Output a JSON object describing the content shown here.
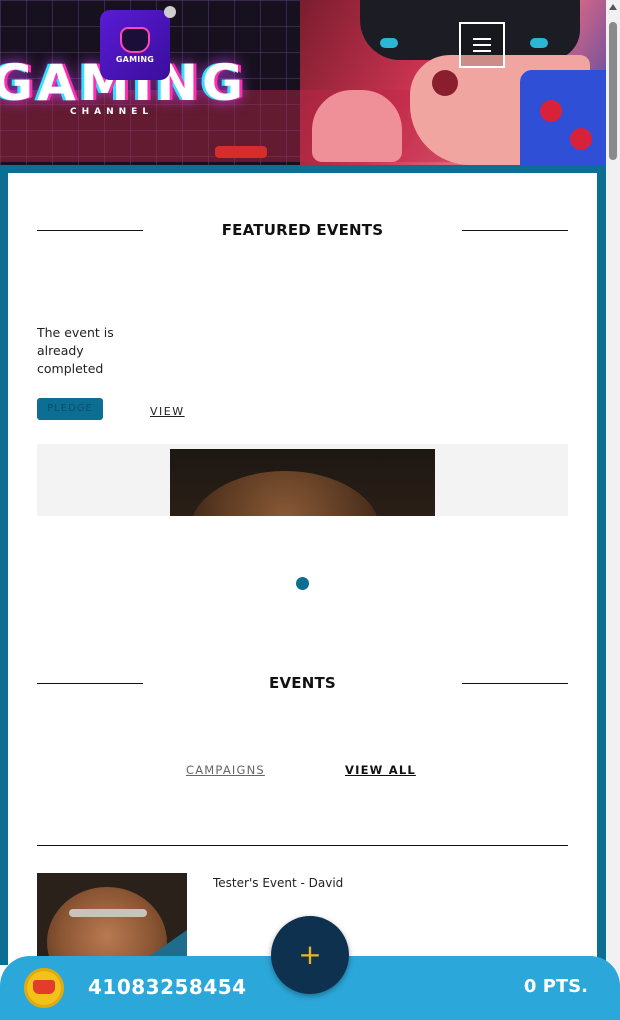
{
  "header": {
    "logo_text": "GAMING",
    "banner_title": "GAMING",
    "banner_subtitle": "CHANNEL",
    "menu_icon": "hamburger-icon"
  },
  "featured": {
    "heading": "FEATURED EVENTS",
    "status_text": "The event is already completed",
    "pledge_label": "PLEDGE",
    "view_label": "VIEW"
  },
  "events": {
    "heading": "EVENTS",
    "tabs": [
      {
        "label": "CAMPAIGNS",
        "active": false
      },
      {
        "label": "VIEW ALL",
        "active": true
      }
    ],
    "items": [
      {
        "title": "Tester's Event - David"
      }
    ]
  },
  "bottom_bar": {
    "user_id": "41083258454",
    "points": "0 PTS.",
    "fab_symbol": "+"
  },
  "colors": {
    "accent": "#0d6e93",
    "bottom_bar": "#2ba7d9",
    "fab": "#0f3150",
    "fab_plus": "#e8b524"
  }
}
